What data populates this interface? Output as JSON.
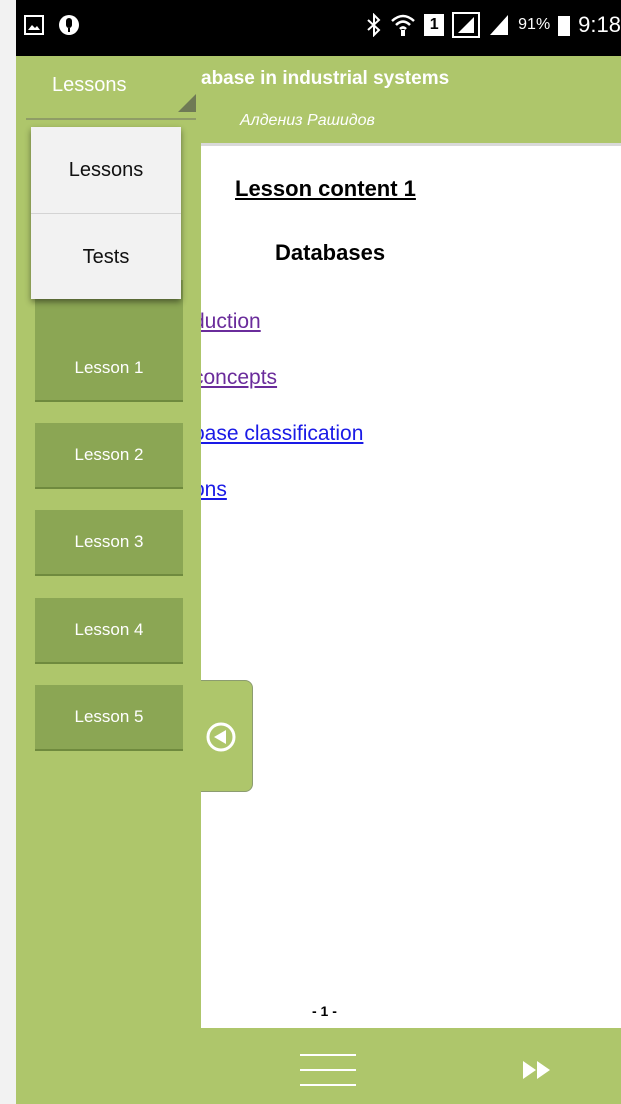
{
  "status_bar": {
    "battery_percent": "91%",
    "time": "9:18",
    "sim_slot": "1"
  },
  "header": {
    "title": "abase in industrial systems",
    "author": "Алдениз Рашидов"
  },
  "content": {
    "lesson_title": "Lesson content 1",
    "subject": "Databases",
    "links": [
      {
        "text": "duction",
        "visited": true
      },
      {
        "text": " concepts",
        "visited": true
      },
      {
        "text": "oase classification",
        "visited": false
      },
      {
        "text": "ons",
        "visited": false
      }
    ],
    "page_number": "- 1 -"
  },
  "drawer": {
    "dropdown_label": "Lessons",
    "lessons": [
      "Lesson 1",
      "Lesson 2",
      "Lesson 3",
      "Lesson 4",
      "Lesson 5"
    ]
  },
  "popup_menu": {
    "items": [
      "Lessons",
      "Tests"
    ],
    "selected": "Lessons"
  },
  "colors": {
    "accent": "#aec66b",
    "button": "#8ba654",
    "visited_link": "#6a2c9b",
    "link": "#1a1ae6"
  },
  "icons": {
    "status_left": [
      "gallery-icon",
      "microphone-icon"
    ],
    "status_right": [
      "bluetooth-icon",
      "wifi-icon",
      "sim-icon",
      "signal-icon",
      "signal-icon",
      "battery-icon"
    ],
    "bottom": [
      "menu-icon",
      "fast-forward-icon"
    ],
    "drawer_handle": "back-arrow-circle-icon"
  }
}
